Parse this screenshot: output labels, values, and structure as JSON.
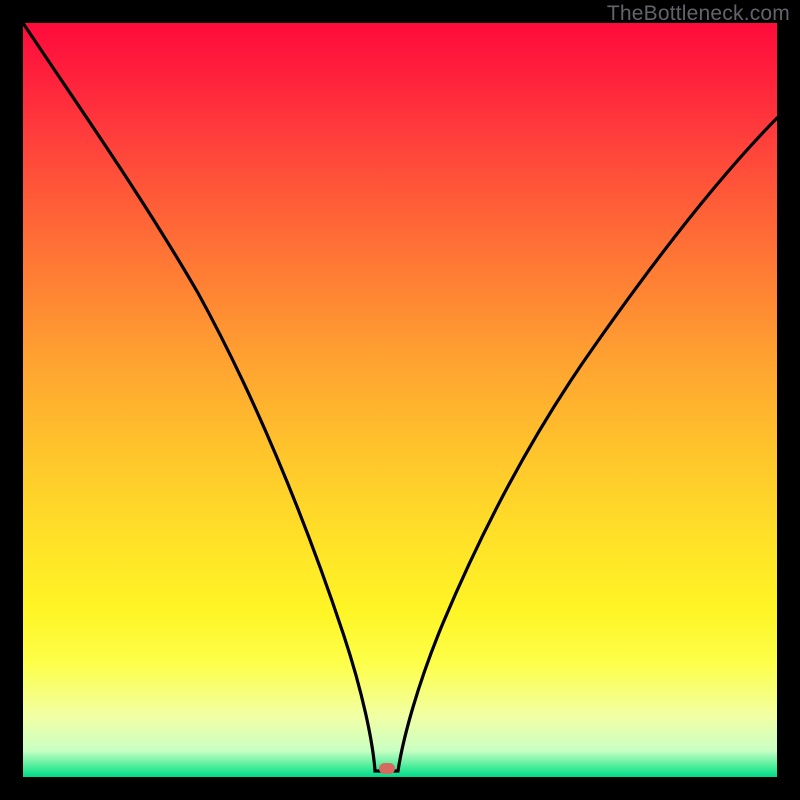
{
  "watermark": "TheBottleneck.com",
  "colors": {
    "background": "#000000",
    "curve_stroke": "#000000",
    "dot_fill": "#d56a5f",
    "gradient_top": "#ff0b3b",
    "gradient_bottom": "#00d98c"
  },
  "chart_data": {
    "type": "line",
    "title": "",
    "xlabel": "",
    "ylabel": "",
    "xlim": [
      0,
      100
    ],
    "ylim": [
      0,
      100
    ],
    "grid": false,
    "legend": false,
    "annotations": [
      {
        "type": "marker",
        "x": 48.5,
        "y": 1,
        "color": "#d56a5f"
      }
    ],
    "series": [
      {
        "name": "curve",
        "x": [
          0,
          4,
          8,
          12,
          16,
          20,
          24,
          28,
          32,
          36,
          40,
          44,
          46,
          48,
          50,
          52,
          56,
          60,
          64,
          68,
          72,
          76,
          80,
          84,
          88,
          92,
          96,
          100
        ],
        "y": [
          100,
          94,
          88,
          82,
          75,
          68,
          61,
          53,
          45,
          36,
          26,
          14,
          6,
          1,
          1,
          6,
          16,
          25,
          33,
          40,
          46,
          52,
          57,
          62,
          66,
          70,
          73,
          76
        ]
      }
    ]
  }
}
